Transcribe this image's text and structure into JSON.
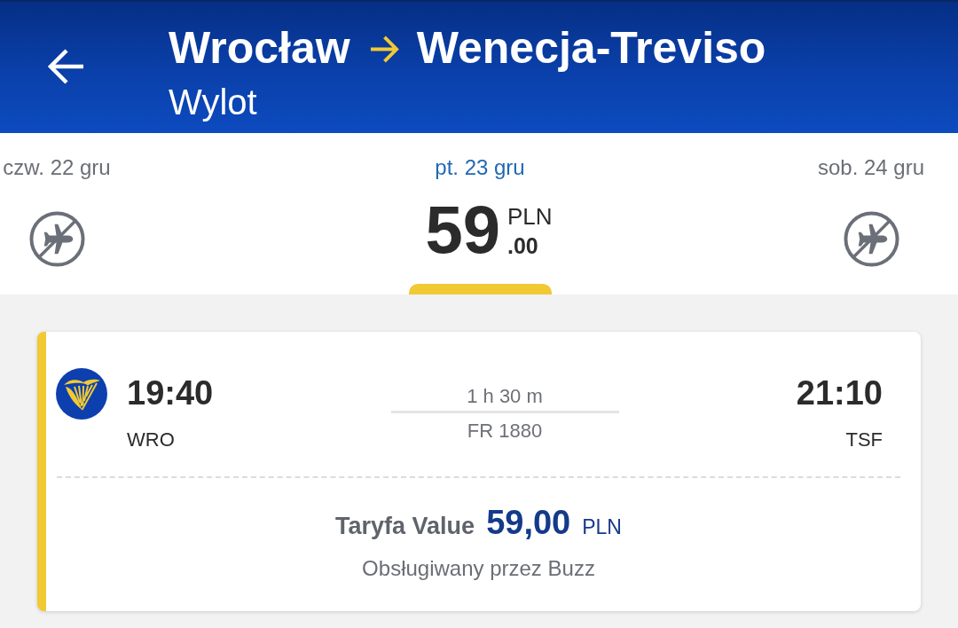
{
  "header": {
    "origin": "Wrocław",
    "destination": "Wenecja-Treviso",
    "subtitle": "Wylot"
  },
  "dates": [
    {
      "label": "czw. 22 gru",
      "kind": "no-flights",
      "selected": false
    },
    {
      "label": "pt. 23 gru",
      "kind": "price",
      "selected": true,
      "price": {
        "amount": "59",
        "currency": "PLN",
        "decimals": ".00"
      }
    },
    {
      "label": "sob. 24 gru",
      "kind": "no-flights",
      "selected": false
    }
  ],
  "flight": {
    "departure_time": "19:40",
    "departure_code": "WRO",
    "duration": "1 h 30 m",
    "flight_number": "FR 1880",
    "arrival_time": "21:10",
    "arrival_code": "TSF",
    "fare_label": "Taryfa Value",
    "fare_amount": "59,00",
    "fare_currency": "PLN",
    "operator": "Obsługiwany przez Buzz"
  }
}
